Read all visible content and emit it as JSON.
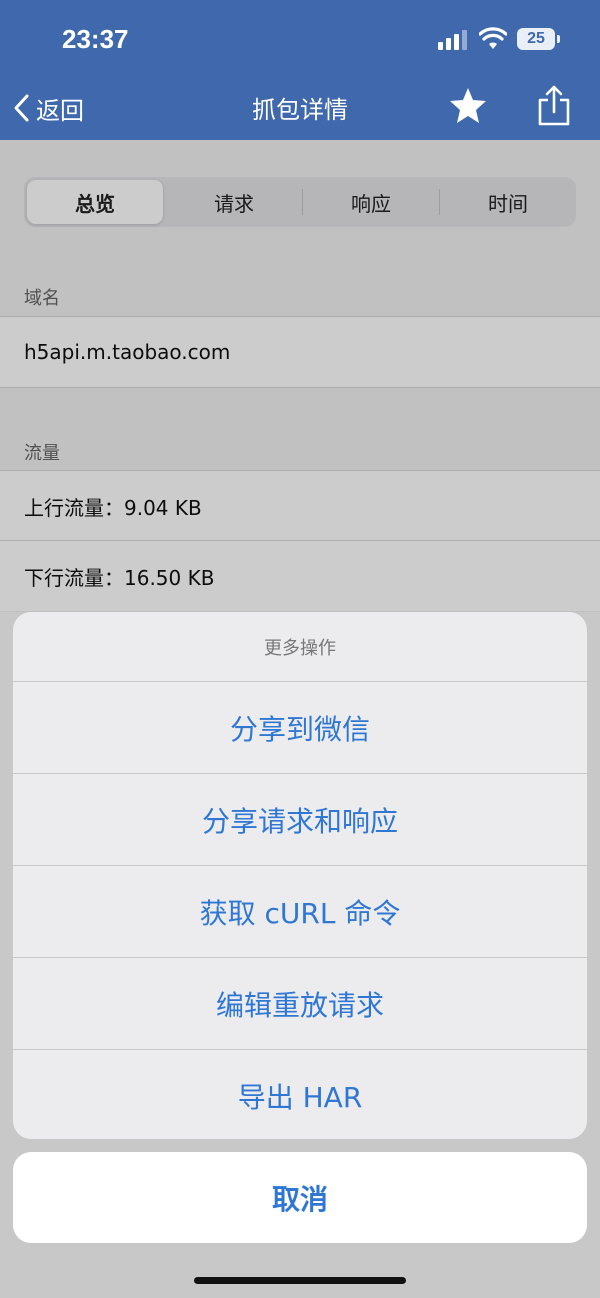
{
  "status_bar": {
    "time": "23:37",
    "battery": "25"
  },
  "nav": {
    "back_label": "返回",
    "title": "抓包详情"
  },
  "tabs": [
    {
      "label": "总览"
    },
    {
      "label": "请求"
    },
    {
      "label": "响应"
    },
    {
      "label": "时间"
    }
  ],
  "sections": {
    "domain": {
      "header": "域名",
      "value": "h5api.m.taobao.com"
    },
    "traffic": {
      "header": "流量",
      "upload": "上行流量：9.04 KB",
      "download": "下行流量：16.50 KB"
    }
  },
  "action_sheet": {
    "title": "更多操作",
    "actions": [
      {
        "label": "分享到微信"
      },
      {
        "label": "分享请求和响应"
      },
      {
        "label": "获取 cURL 命令"
      },
      {
        "label": "编辑重放请求"
      },
      {
        "label": "导出 HAR"
      }
    ],
    "cancel_label": "取消"
  },
  "colors": {
    "nav_bg": "#3f68ad",
    "action_blue": "#2f77d4"
  },
  "icons": [
    "chevron-left-icon",
    "star-icon",
    "share-icon",
    "signal-icon",
    "wifi-icon",
    "battery-icon"
  ]
}
